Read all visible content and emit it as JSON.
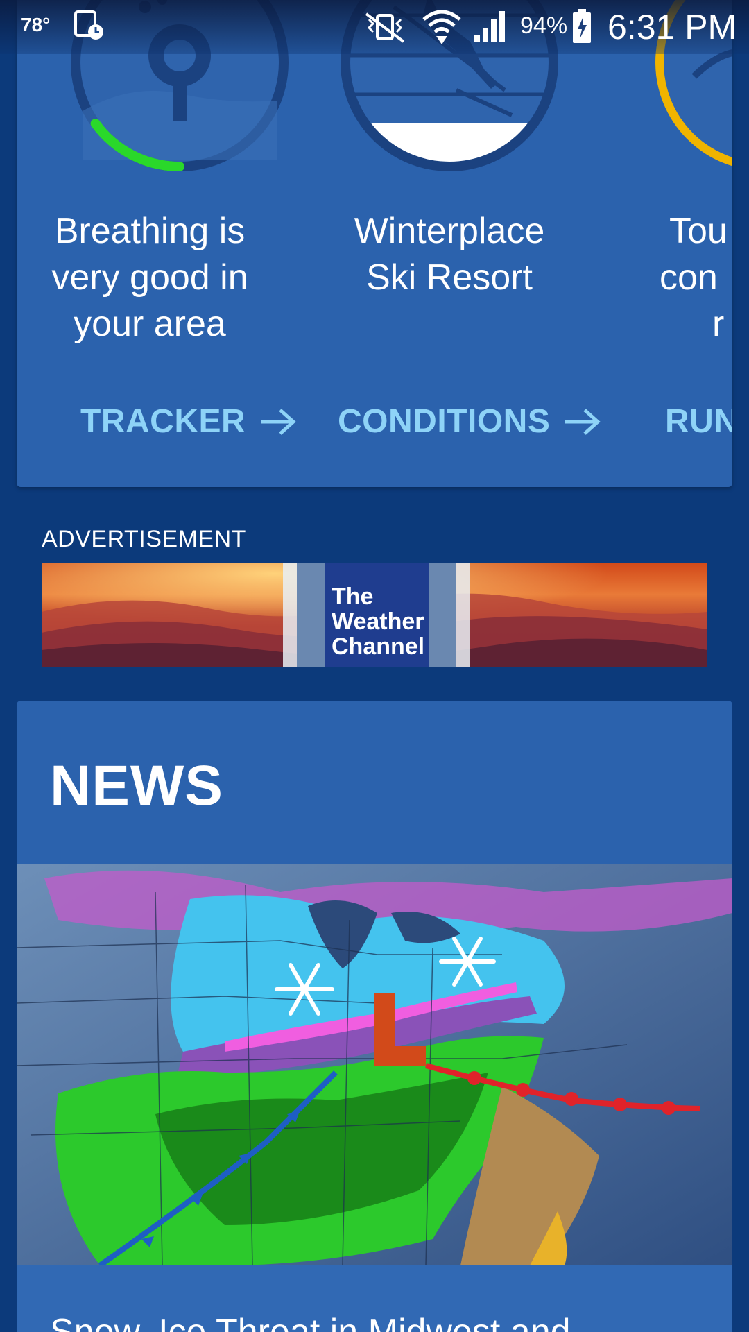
{
  "status_bar": {
    "temperature": "78°",
    "battery_percent": "94%",
    "time": "6:31 PM",
    "icons": [
      "calendar-clock-icon",
      "vibrate-mute-icon",
      "wifi-icon",
      "cell-signal-icon",
      "battery-charging-icon"
    ]
  },
  "cards": [
    {
      "title_lines": [
        "Breathing is",
        "very good in",
        "your area"
      ],
      "link_label": "TRACKER",
      "icon": "air-quality-icon",
      "ring_color": "#2ad82a",
      "ring_level": 0.15
    },
    {
      "title_lines": [
        "Winterplace",
        "Ski Resort"
      ],
      "link_label": "CONDITIONS",
      "icon": "skier-icon"
    },
    {
      "title_lines": [
        "Tou",
        "con",
        "r"
      ],
      "link_label": "RUN T",
      "icon": "outdoor-activity-icon",
      "ring_color": "#f0b400"
    }
  ],
  "advertisement": {
    "label": "ADVERTISEMENT",
    "logo_lines": [
      "The",
      "Weather",
      "Channel"
    ]
  },
  "news": {
    "section_title": "NEWS",
    "headline": "Snow, Ice Threat in Midwest and"
  },
  "colors": {
    "background": "#0c3a7b",
    "card": "#2b62ad",
    "link": "#8ed3f7"
  }
}
